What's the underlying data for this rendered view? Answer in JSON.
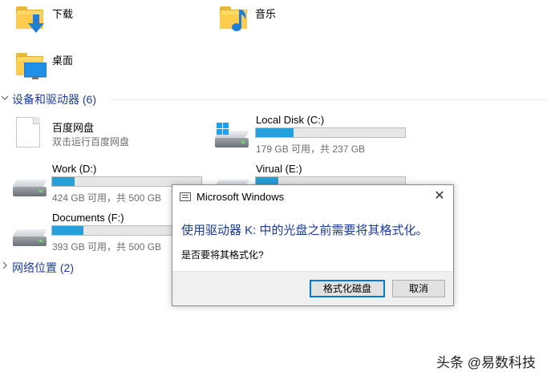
{
  "folders": [
    {
      "label": "下载",
      "icon": "download-folder-icon"
    },
    {
      "label": "音乐",
      "icon": "music-folder-icon"
    },
    {
      "label": "桌面",
      "icon": "desktop-folder-icon"
    }
  ],
  "devices_section": {
    "title": "设备和驱动器 (6)",
    "expanded": true
  },
  "network_section": {
    "title": "网络位置 (2)",
    "expanded": false
  },
  "baidu": {
    "name": "百度网盘",
    "subtitle": "双击运行百度网盘"
  },
  "drives": [
    {
      "name": "Local Disk (C:)",
      "info": "179 GB 可用，共 237 GB",
      "used_fraction": 0.25
    },
    {
      "name": "Work (D:)",
      "info": "424 GB 可用，共 500 GB",
      "used_fraction": 0.15
    },
    {
      "name": "Virual (E:)",
      "info": "",
      "used_fraction": 0.15
    },
    {
      "name": "Documents (F:)",
      "info": "393 GB 可用，共 500 GB",
      "used_fraction": 0.21
    }
  ],
  "dialog": {
    "title": "Microsoft Windows",
    "close_glyph": "✕",
    "main_instruction": "使用驱动器 K: 中的光盘之前需要将其格式化。",
    "content": "是否要将其格式化?",
    "format_button": "格式化磁盘",
    "cancel_button": "取消"
  },
  "watermark": "头条 @易数科技",
  "colors": {
    "accent": "#26a0da",
    "section_header": "#1e3d9c",
    "instruction": "#1b3b99"
  }
}
